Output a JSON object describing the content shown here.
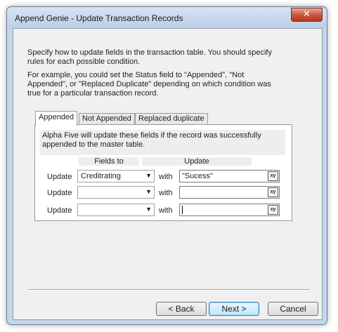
{
  "window": {
    "title": "Append Genie - Update Transaction Records",
    "close_glyph": "✕"
  },
  "instructions": {
    "line1": "Specify how to update fields in the transaction table. You should specify rules for each possible condition.",
    "line2": "For example, you could set the Status field to \"Appended\", \"Not Appended\", or \"Replaced Duplicate\" depending on which condition was true for a particular transaction record."
  },
  "tabs": [
    {
      "label": "Appended",
      "active": true
    },
    {
      "label": "Not Appended",
      "active": false
    },
    {
      "label": "Replaced duplicate",
      "active": false
    }
  ],
  "panel": {
    "note": "Alpha Five will update these fields if the record was successfully appended to the master table.",
    "col_fields": "Fields to",
    "col_update": "Update",
    "rows": [
      {
        "label": "Update",
        "field": "Creditrating",
        "with": "with",
        "value": "\"Sucess\""
      },
      {
        "label": "Update",
        "field": "",
        "with": "with",
        "value": ""
      },
      {
        "label": "Update",
        "field": "",
        "with": "with",
        "value": ""
      }
    ]
  },
  "buttons": {
    "back": "< Back",
    "next": "Next >",
    "cancel": "Cancel"
  },
  "icons": {
    "dropdown": "chevron-down-icon",
    "expression": "expression-builder-icon"
  },
  "colors": {
    "title_bar": "#c5d6e9",
    "close": "#c7513b",
    "default_button": "#bee6fd"
  }
}
